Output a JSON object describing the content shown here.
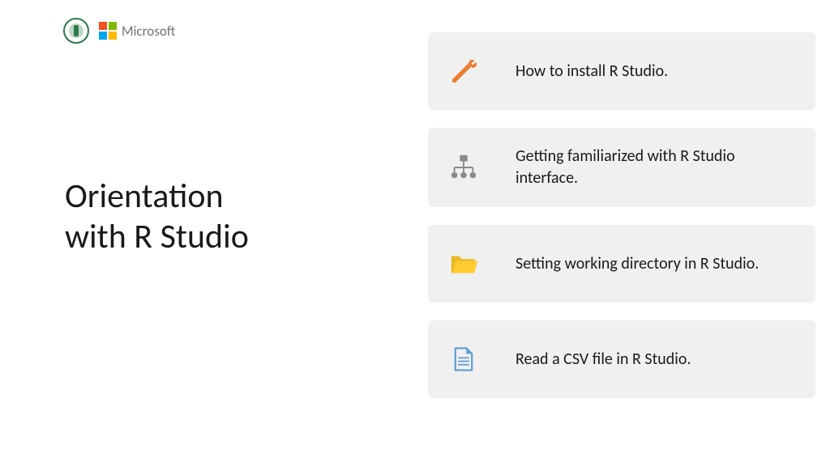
{
  "logo": {
    "microsoft_text": "Microsoft"
  },
  "title": {
    "line1": "Orientation",
    "line2": "with R Studio"
  },
  "cards": [
    {
      "icon": "tools-icon",
      "text": "How to install R Studio."
    },
    {
      "icon": "hierarchy-icon",
      "text": "Getting familiarized with R Studio interface."
    },
    {
      "icon": "folder-icon",
      "text": "Setting working directory in R Studio."
    },
    {
      "icon": "file-icon",
      "text": "Read a CSV file in R Studio."
    }
  ]
}
